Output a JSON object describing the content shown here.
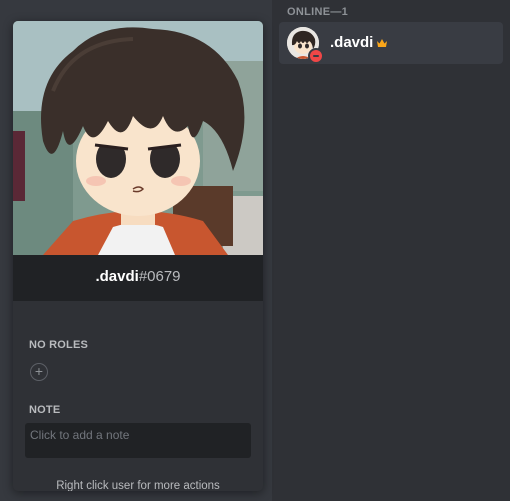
{
  "profile": {
    "username": ".davdi",
    "discriminator": "#0679",
    "roles_title": "NO ROLES",
    "add_role_glyph": "+",
    "note_title": "NOTE",
    "note_placeholder": "Click to add a note",
    "footer_hint": "Right click user for more actions"
  },
  "member_list": {
    "group_header": "ONLINE—1",
    "members": [
      {
        "name": ".davdi",
        "status": "dnd",
        "badge_icon": "crown-icon"
      }
    ]
  },
  "colors": {
    "background": "#36393f",
    "panel": "#2f3136",
    "name_bar": "#202225",
    "dnd_status": "#f04747",
    "crown": "#faa61a"
  }
}
